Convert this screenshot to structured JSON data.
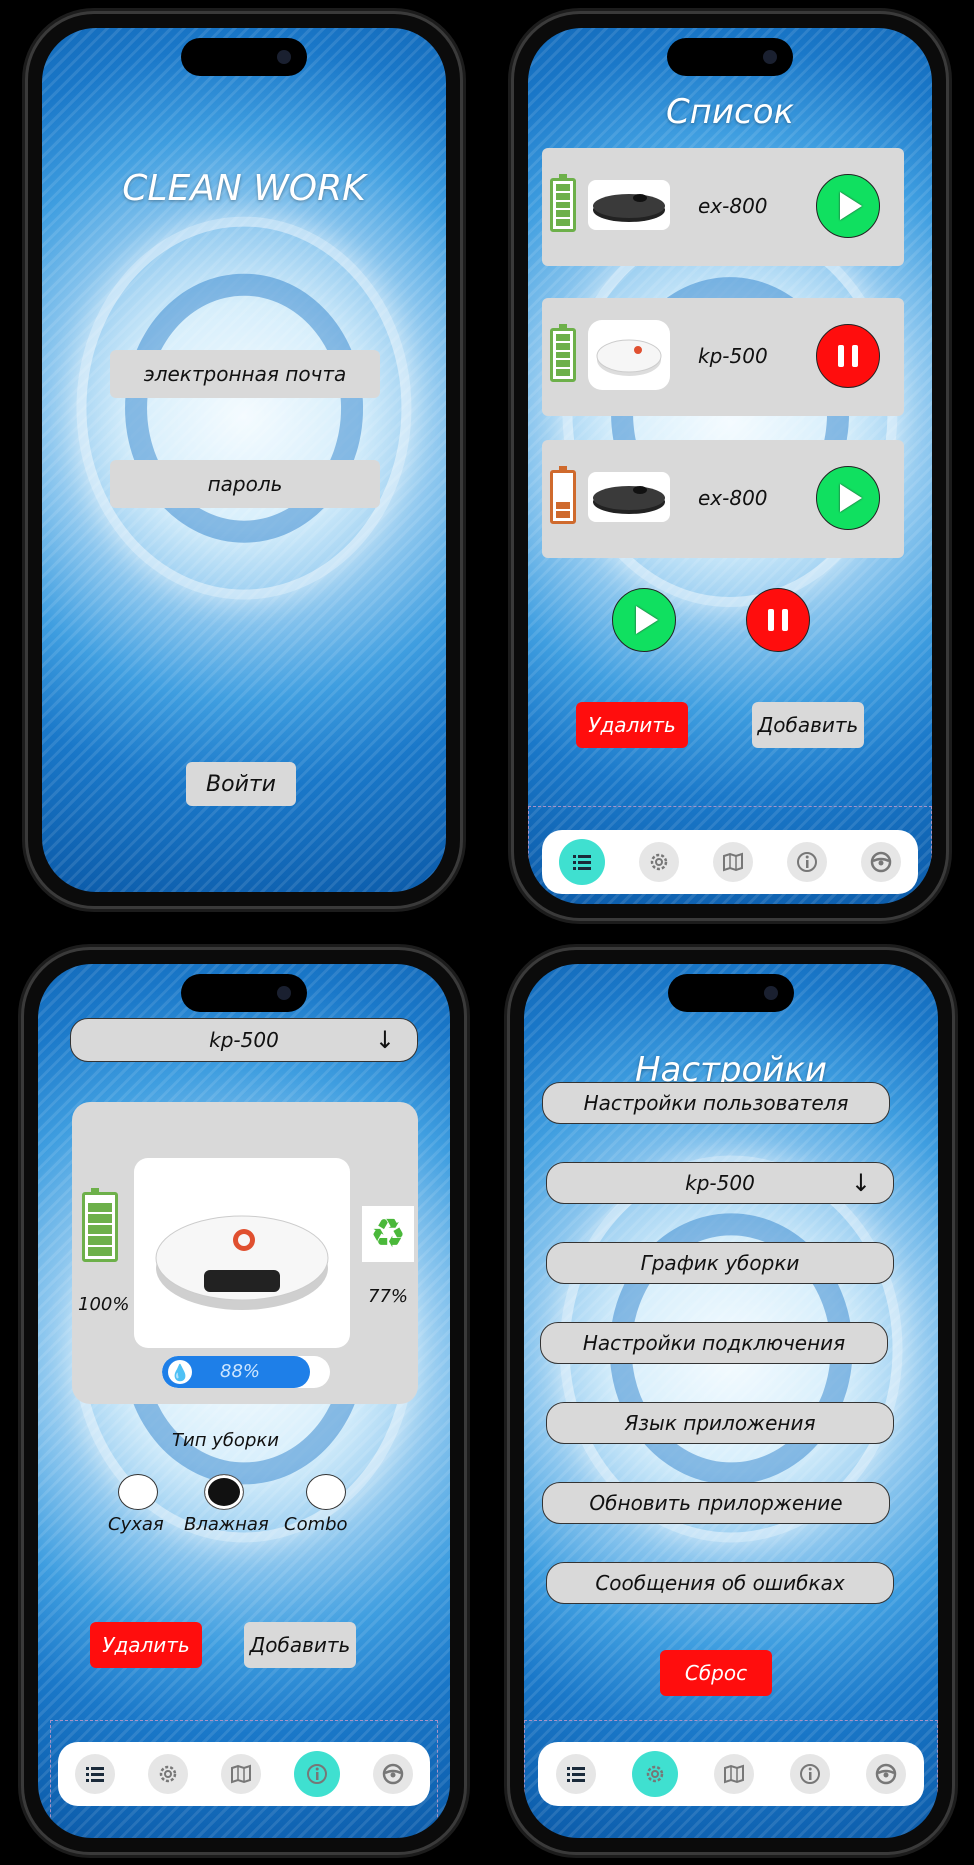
{
  "login": {
    "title": "CLEAN WORK",
    "email_placeholder": "электронная почта",
    "password_placeholder": "пароль",
    "login_button": "Войти"
  },
  "list": {
    "title": "Список",
    "devices": [
      {
        "name": "ex-800",
        "battery": "full",
        "state": "play"
      },
      {
        "name": "kp-500",
        "battery": "full",
        "state": "pause"
      },
      {
        "name": "ex-800",
        "battery": "low",
        "state": "play"
      }
    ],
    "delete_button": "Удалить",
    "add_button": "Добавить"
  },
  "device": {
    "selector_value": "kp-500",
    "battery_percent": "100%",
    "recycle_percent": "77%",
    "water_percent": "88%",
    "water_level": 0.88,
    "cleaning_type_label": "Тип уборки",
    "modes": [
      "Сухая",
      "Влажная",
      "Combo"
    ],
    "selected_mode": "Влажная",
    "delete_button": "Удалить",
    "add_button": "Добавить"
  },
  "settings": {
    "title": "Настройки",
    "user_settings": "Настройки пользователя",
    "device_selector": "kp-500",
    "schedule": "График уборки",
    "connection": "Настройки подключения",
    "language": "Язык приложения",
    "update": "Обновить прилоржение",
    "errors": "Сообщения об ошибках",
    "reset": "Сброс"
  },
  "nav": {
    "items": [
      "list-icon",
      "gear-icon",
      "map-icon",
      "info-icon",
      "steering-wheel-icon"
    ]
  },
  "colors": {
    "accent_teal": "#3fe0d0",
    "play_green": "#10e060",
    "danger_red": "#ff0d0d",
    "control_gray": "#d9d9d9"
  }
}
